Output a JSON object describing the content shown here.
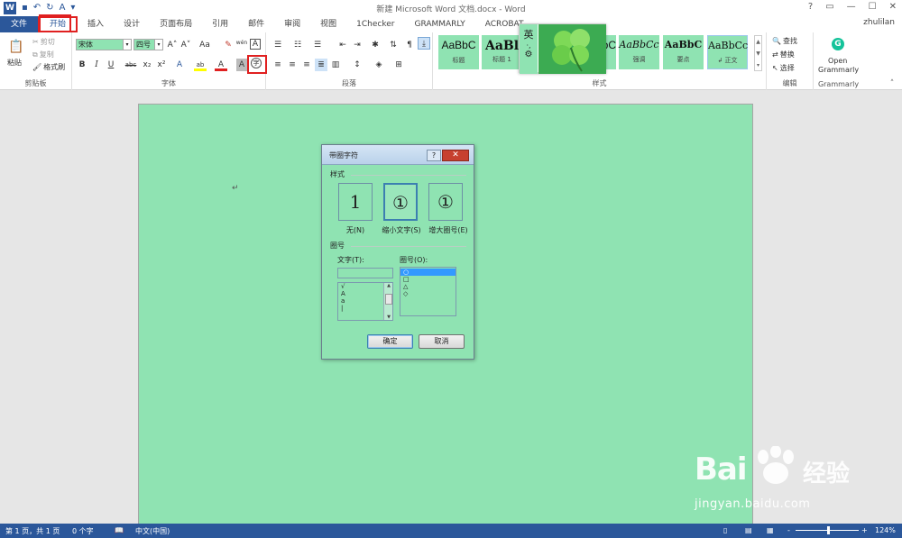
{
  "titlebar": {
    "title": "新建 Microsoft Word 文档.docx - Word",
    "qat": {
      "app_icon": "W",
      "save_icon": "▪",
      "undo_icon": "↶",
      "redo_icon": "↻",
      "spell_icon": "A",
      "customize_icon": "▾"
    },
    "window_controls": {
      "help": "?",
      "ribbon_display": "▭",
      "minimize": "—",
      "maximize": "☐",
      "close": "✕"
    }
  },
  "tabs": {
    "file": "文件",
    "items": [
      "开始",
      "插入",
      "设计",
      "页面布局",
      "引用",
      "邮件",
      "审阅",
      "视图",
      "1Checker",
      "GRAMMARLY",
      "ACROBAT"
    ],
    "active_index": 0,
    "user": "zhulilan"
  },
  "ribbon": {
    "clipboard": {
      "label": "剪贴板",
      "paste": "粘贴",
      "cut": "剪切",
      "copy": "复制",
      "format_painter": "格式刷"
    },
    "font": {
      "label": "字体",
      "font_name": "宋体",
      "font_size": "四号",
      "grow": "A˄",
      "shrink": "A˅",
      "case": "Aa",
      "clear": "✎",
      "phonetic": "wén",
      "border": "A",
      "bold": "B",
      "italic": "I",
      "underline": "U",
      "strike": "abc",
      "subscript": "x₂",
      "superscript": "x²",
      "effects": "A",
      "highlight": "ab",
      "color": "A",
      "shade": "A",
      "enclose": "字"
    },
    "paragraph": {
      "label": "段落"
    },
    "styles": {
      "label": "样式",
      "items": [
        {
          "sample": "AaBbC",
          "name": "标题"
        },
        {
          "sample": "AaBl",
          "name": "标题 1"
        },
        {
          "sample": "AaBbC",
          "name": ""
        },
        {
          "sample": "AaBbCc",
          "name": "强调"
        },
        {
          "sample": "AaBbC",
          "name": "要点"
        },
        {
          "sample": "AaBbCc",
          "name": "↲ 正文"
        }
      ]
    },
    "editing": {
      "label": "编辑",
      "find": "查找",
      "replace": "替换",
      "select": "选择"
    },
    "grammarly": {
      "label": "Grammarly",
      "open_line1": "Open",
      "open_line2": "Grammarly"
    }
  },
  "ime": {
    "lang": "英",
    "punct": "·,",
    "settings": "⚙"
  },
  "document": {
    "para_mark": "↵"
  },
  "dialog": {
    "title": "带圈字符",
    "help": "?",
    "close": "✕",
    "style_section": "样式",
    "styles": [
      {
        "glyph": "1",
        "label": "无(N)"
      },
      {
        "glyph": "①",
        "label": "缩小文字(S)"
      },
      {
        "glyph": "①",
        "label": "增大圈号(E)"
      }
    ],
    "selected_style_index": 1,
    "circle_section": "圈号",
    "text_label": "文字(T):",
    "text_value": "",
    "text_list": [
      "√",
      "A",
      "a",
      "|"
    ],
    "circle_label": "圈号(O):",
    "circle_list": [
      "○",
      "□",
      "△",
      "◇"
    ],
    "circle_selected_index": 0,
    "ok": "确定",
    "cancel": "取消"
  },
  "statusbar": {
    "page": "第 1 页，共 1 页",
    "words": "0 个字",
    "proof_icon": "📖",
    "language": "中文(中国)",
    "zoom_minus": "-",
    "zoom_plus": "+",
    "zoom": "124%"
  },
  "watermark": {
    "brand": "Bai",
    "brand_cn": "经验",
    "url": "jingyan.baidu.com"
  },
  "colors": {
    "page": "#8fe3b2",
    "accent": "#2b579a",
    "highlight": "#e02020"
  }
}
